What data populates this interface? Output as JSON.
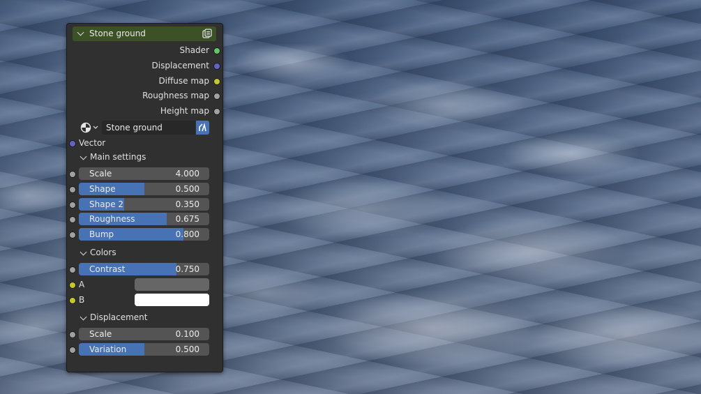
{
  "node": {
    "title": "Stone ground",
    "header_color": "#3c5226",
    "outputs": [
      {
        "label": "Shader",
        "socket_color": "#63c763"
      },
      {
        "label": "Displacement",
        "socket_color": "#6363c7"
      },
      {
        "label": "Diffuse map",
        "socket_color": "#c7c729"
      },
      {
        "label": "Roughness map",
        "socket_color": "#a1a1a1"
      },
      {
        "label": "Height map",
        "socket_color": "#a1a1a1"
      }
    ],
    "group_selector": {
      "value": "Stone ground",
      "type_icon": "node-tree-icon",
      "action_icon": "fake-user-icon"
    },
    "vector_input": {
      "label": "Vector"
    },
    "sections": {
      "main": {
        "label": "Main settings",
        "fields": [
          {
            "name": "Scale",
            "value": "4.000",
            "fraction": 0.0
          },
          {
            "name": "Shape",
            "value": "0.500",
            "fraction": 0.5
          },
          {
            "name": "Shape 2",
            "value": "0.350",
            "fraction": 0.35
          },
          {
            "name": "Roughness",
            "value": "0.675",
            "fraction": 0.675
          },
          {
            "name": "Bump",
            "value": "0.800",
            "fraction": 0.8
          }
        ]
      },
      "colors": {
        "label": "Colors",
        "contrast": {
          "name": "Contrast",
          "value": "0.750",
          "fraction": 0.75
        },
        "a": {
          "label": "A",
          "color": "#666666"
        },
        "b": {
          "label": "B",
          "color": "#ffffff"
        }
      },
      "displacement": {
        "label": "Displacement",
        "fields": [
          {
            "name": "Scale",
            "value": "0.100",
            "fraction": 0.0
          },
          {
            "name": "Variation",
            "value": "0.500",
            "fraction": 0.5
          }
        ]
      }
    }
  },
  "theme": {
    "accent": "#4772b3",
    "panel": "#303030",
    "field": "#545454"
  }
}
